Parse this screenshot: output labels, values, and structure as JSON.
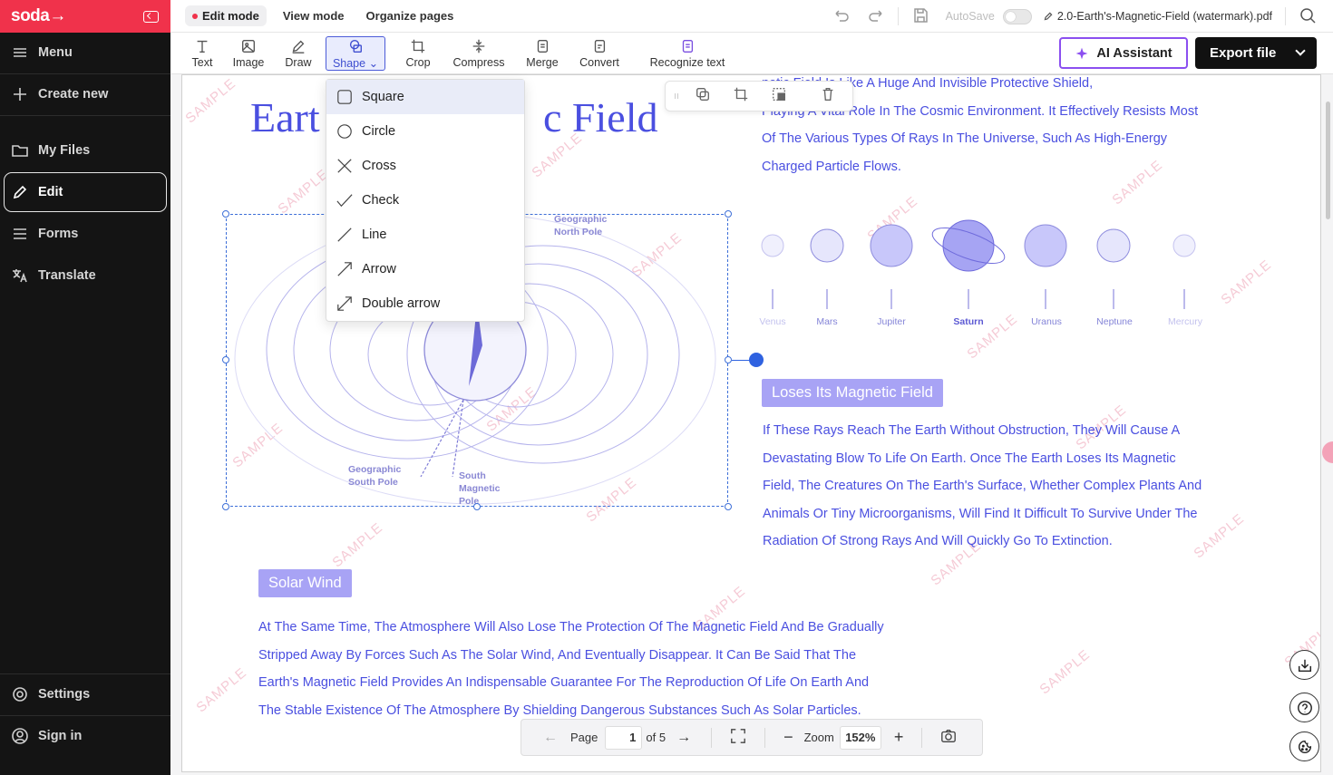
{
  "app": {
    "logo": "soda→"
  },
  "sidebar": {
    "menu": "Menu",
    "create": "Create new",
    "items": [
      {
        "label": "My Files",
        "icon": "folder-icon"
      },
      {
        "label": "Edit",
        "icon": "pencil-icon",
        "active": true
      },
      {
        "label": "Forms",
        "icon": "list-icon"
      },
      {
        "label": "Translate",
        "icon": "translate-icon"
      }
    ],
    "settings": "Settings",
    "signin": "Sign in"
  },
  "topbar": {
    "edit_mode": "Edit mode",
    "view_mode": "View mode",
    "organize": "Organize pages",
    "autosave": "AutoSave",
    "filename": "2.0-Earth's-Magnetic-Field (watermark).pdf"
  },
  "toolbar": {
    "tools": [
      "Text",
      "Image",
      "Draw",
      "Shape",
      "Crop",
      "Compress",
      "Merge",
      "Convert",
      "Recognize text"
    ],
    "ai": "AI Assistant",
    "export": "Export file"
  },
  "shape_menu": [
    "Square",
    "Circle",
    "Cross",
    "Check",
    "Line",
    "Arrow",
    "Double arrow"
  ],
  "document": {
    "title_left": "Eart",
    "title_right": "c Field",
    "para_top": [
      "netic Field Is Like A Huge And Invisible Protective Shield,",
      "Playing A Vital Role In The Cosmic Environment. It Effectively Resists Most",
      "Of The Various Types Of Rays In The Universe, Such As High-Energy",
      "Charged Particle Flows."
    ],
    "diagram_labels": {
      "north": "Geographic North Pole",
      "south_geo": "Geographic South Pole",
      "south_mag": "South Magnetic Pole"
    },
    "planets": [
      "Venus",
      "Mars",
      "Jupiter",
      "Saturn",
      "Uranus",
      "Neptune",
      "Mercury"
    ],
    "tag1": "Loses Its Magnetic Field",
    "para_mid": [
      "If These Rays Reach The Earth Without Obstruction, They Will Cause A",
      "Devastating Blow To Life On Earth. Once The Earth Loses Its Magnetic",
      "Field, The Creatures On The Earth's Surface, Whether Complex Plants And",
      "Animals Or Tiny Microorganisms, Will Find It Difficult To Survive Under The",
      "Radiation Of Strong Rays And Will Quickly Go To Extinction."
    ],
    "tag2": "Solar Wind",
    "para_bot": [
      "At The Same Time, The Atmosphere Will Also Lose The Protection Of The Magnetic Field And Be Gradually",
      "Stripped Away By Forces Such As The Solar Wind, And Eventually Disappear. It Can Be Said That The",
      "Earth's Magnetic Field Provides An Indispensable Guarantee For The Reproduction Of Life On Earth And",
      "The Stable Existence Of The Atmosphere By Shielding Dangerous Substances Such As Solar Particles."
    ],
    "watermark": "SAMPLE"
  },
  "pager": {
    "page_label": "Page",
    "page": "1",
    "of": "of 5",
    "zoom_label": "Zoom",
    "zoom": "152%"
  }
}
